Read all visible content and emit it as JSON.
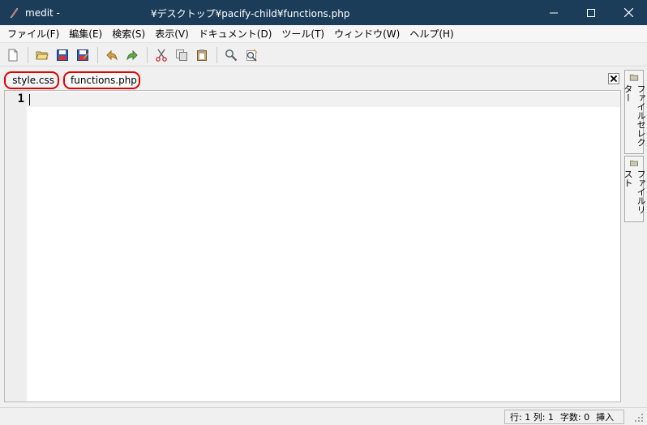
{
  "window": {
    "app_name": "medit -",
    "path": "¥デスクトップ¥pacify-child¥functions.php"
  },
  "menu": [
    "ファイル(F)",
    "編集(E)",
    "検索(S)",
    "表示(V)",
    "ドキュメント(D)",
    "ツール(T)",
    "ウィンドウ(W)",
    "ヘルプ(H)"
  ],
  "toolbar_icons": [
    "new-document-icon",
    "open-folder-icon",
    "save-icon",
    "save-as-icon",
    "undo-icon",
    "redo-icon",
    "cut-icon",
    "copy-icon",
    "paste-icon",
    "find-icon",
    "find-replace-icon"
  ],
  "tabs": [
    {
      "label": "style.css",
      "active": false
    },
    {
      "label": "functions.php",
      "active": true
    }
  ],
  "editor": {
    "line_numbers": [
      "1"
    ],
    "content": ""
  },
  "side_panel": {
    "tabs": [
      "ファイルセレクター",
      "ファイルリスト"
    ]
  },
  "status": {
    "position": "行: 1 列: 1",
    "char_count": "字数: 0",
    "mode": "挿入"
  },
  "colors": {
    "titlebar": "#1c3d5a",
    "tab_highlight": "#e00000"
  }
}
